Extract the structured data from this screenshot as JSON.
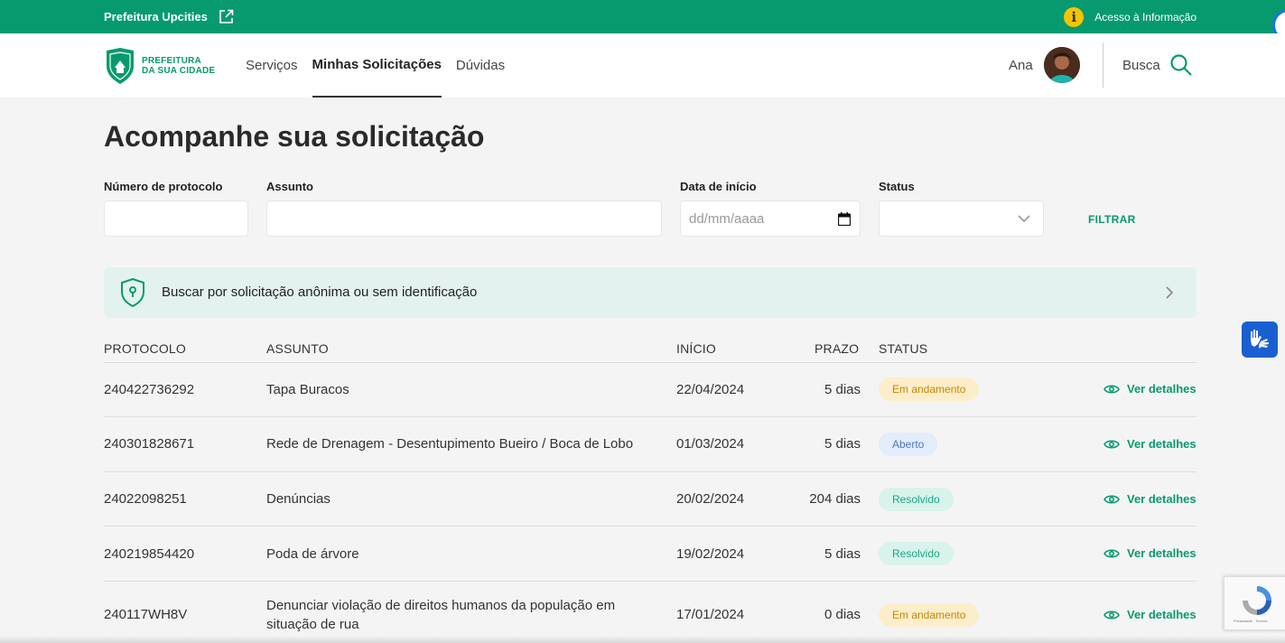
{
  "topbar": {
    "site_name": "Prefeitura Upcities",
    "access_info": "Acesso à Informação"
  },
  "header": {
    "logo": {
      "line1": "PREFEITURA",
      "line2": "DA SUA CIDADE"
    },
    "nav": [
      {
        "label": "Serviços"
      },
      {
        "label": "Minhas Solicitações",
        "active": true
      },
      {
        "label": "Dúvidas"
      }
    ],
    "user_name": "Ana",
    "search_label": "Busca"
  },
  "page": {
    "title": "Acompanhe sua solicitação"
  },
  "filters": {
    "protocol_label": "Número de protocolo",
    "protocol_value": "",
    "subject_label": "Assunto",
    "subject_value": "",
    "date_label": "Data de início",
    "date_placeholder": "dd/mm/aaaa",
    "status_label": "Status",
    "status_value": "",
    "filter_button": "FILTRAR"
  },
  "anonymous": {
    "label": "Buscar por solicitação anônima ou sem identificação"
  },
  "table": {
    "headers": {
      "protocol": "PROTOCOLO",
      "subject": "ASSUNTO",
      "start": "INÍCIO",
      "deadline": "PRAZO",
      "status": "STATUS"
    },
    "details_label": "Ver detalhes",
    "rows": [
      {
        "protocol": "240422736292",
        "subject": "Tapa Buracos",
        "start": "22/04/2024",
        "deadline": "5 dias",
        "status": "Em andamento",
        "status_kind": "and"
      },
      {
        "protocol": "240301828671",
        "subject": "Rede de Drenagem - Desentupimento Bueiro / Boca de Lobo",
        "start": "01/03/2024",
        "deadline": "5 dias",
        "status": "Aberto",
        "status_kind": "abe"
      },
      {
        "protocol": "24022098251",
        "subject": "Denúncias",
        "start": "20/02/2024",
        "deadline": "204 dias",
        "status": "Resolvido",
        "status_kind": "res"
      },
      {
        "protocol": "240219854420",
        "subject": "Poda de árvore",
        "start": "19/02/2024",
        "deadline": "5 dias",
        "status": "Resolvido",
        "status_kind": "res"
      },
      {
        "protocol": "240117WH8V",
        "subject_line1": "Denunciar violação de direitos humanos da população em",
        "subject_line2": "situação de rua",
        "start": "17/01/2024",
        "deadline": "0 dias",
        "status": "Em andamento",
        "status_kind": "and"
      }
    ]
  },
  "recaptcha": {
    "footer": "Privacidade - Termos"
  },
  "colors": {
    "brand": "#079a6f",
    "accent_blue": "#1a5fd0"
  }
}
